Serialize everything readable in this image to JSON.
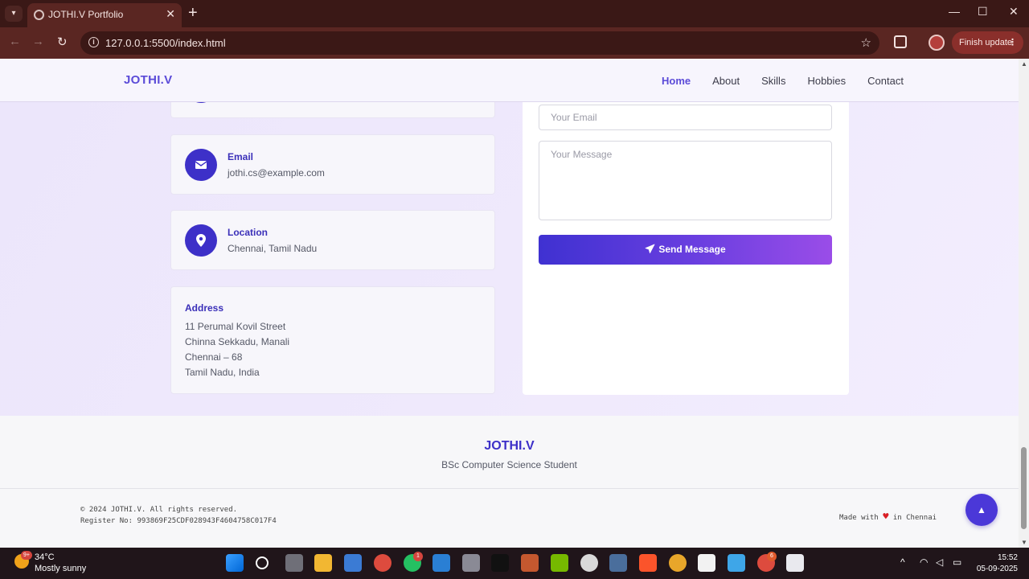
{
  "browser": {
    "tab_title": "JOTHI.V Portfolio",
    "url": "127.0.0.1:5500/index.html",
    "update_label": "Finish update"
  },
  "site": {
    "brand": "JOTHI.V",
    "nav": [
      "Home",
      "About",
      "Skills",
      "Hobbies",
      "Contact"
    ],
    "active_nav": "Home"
  },
  "contact": {
    "email_label": "Email",
    "email_value": "jothi.cs@example.com",
    "location_label": "Location",
    "location_value": "Chennai, Tamil Nadu",
    "address_label": "Address",
    "address_lines": [
      "11 Perumal Kovil Street",
      "Chinna Sekkadu, Manali",
      "Chennai – 68",
      "Tamil Nadu, India"
    ]
  },
  "form": {
    "email_placeholder": "Your Email",
    "message_placeholder": "Your Message",
    "send_label": "Send Message"
  },
  "footer": {
    "brand": "JOTHI.V",
    "tagline": "BSc Computer Science Student",
    "copyright": "© 2024 JOTHI.V. All rights reserved.",
    "register": "Register No: 993869F25CDF028943F4604758C017F4",
    "made_with_prefix": "Made with",
    "made_with_suffix": "in Chennai"
  },
  "taskbar": {
    "temperature": "34°C",
    "condition": "Mostly sunny",
    "weather_badge": "9+",
    "time": "15:52",
    "date": "05-09-2025",
    "whatsapp_badge": "1",
    "chrome_badge": "6"
  },
  "colors": {
    "accent": "#3d30c8",
    "brand": "#5b4bd8",
    "chrome_bg": "#5a2622",
    "heart": "#d91f26"
  }
}
